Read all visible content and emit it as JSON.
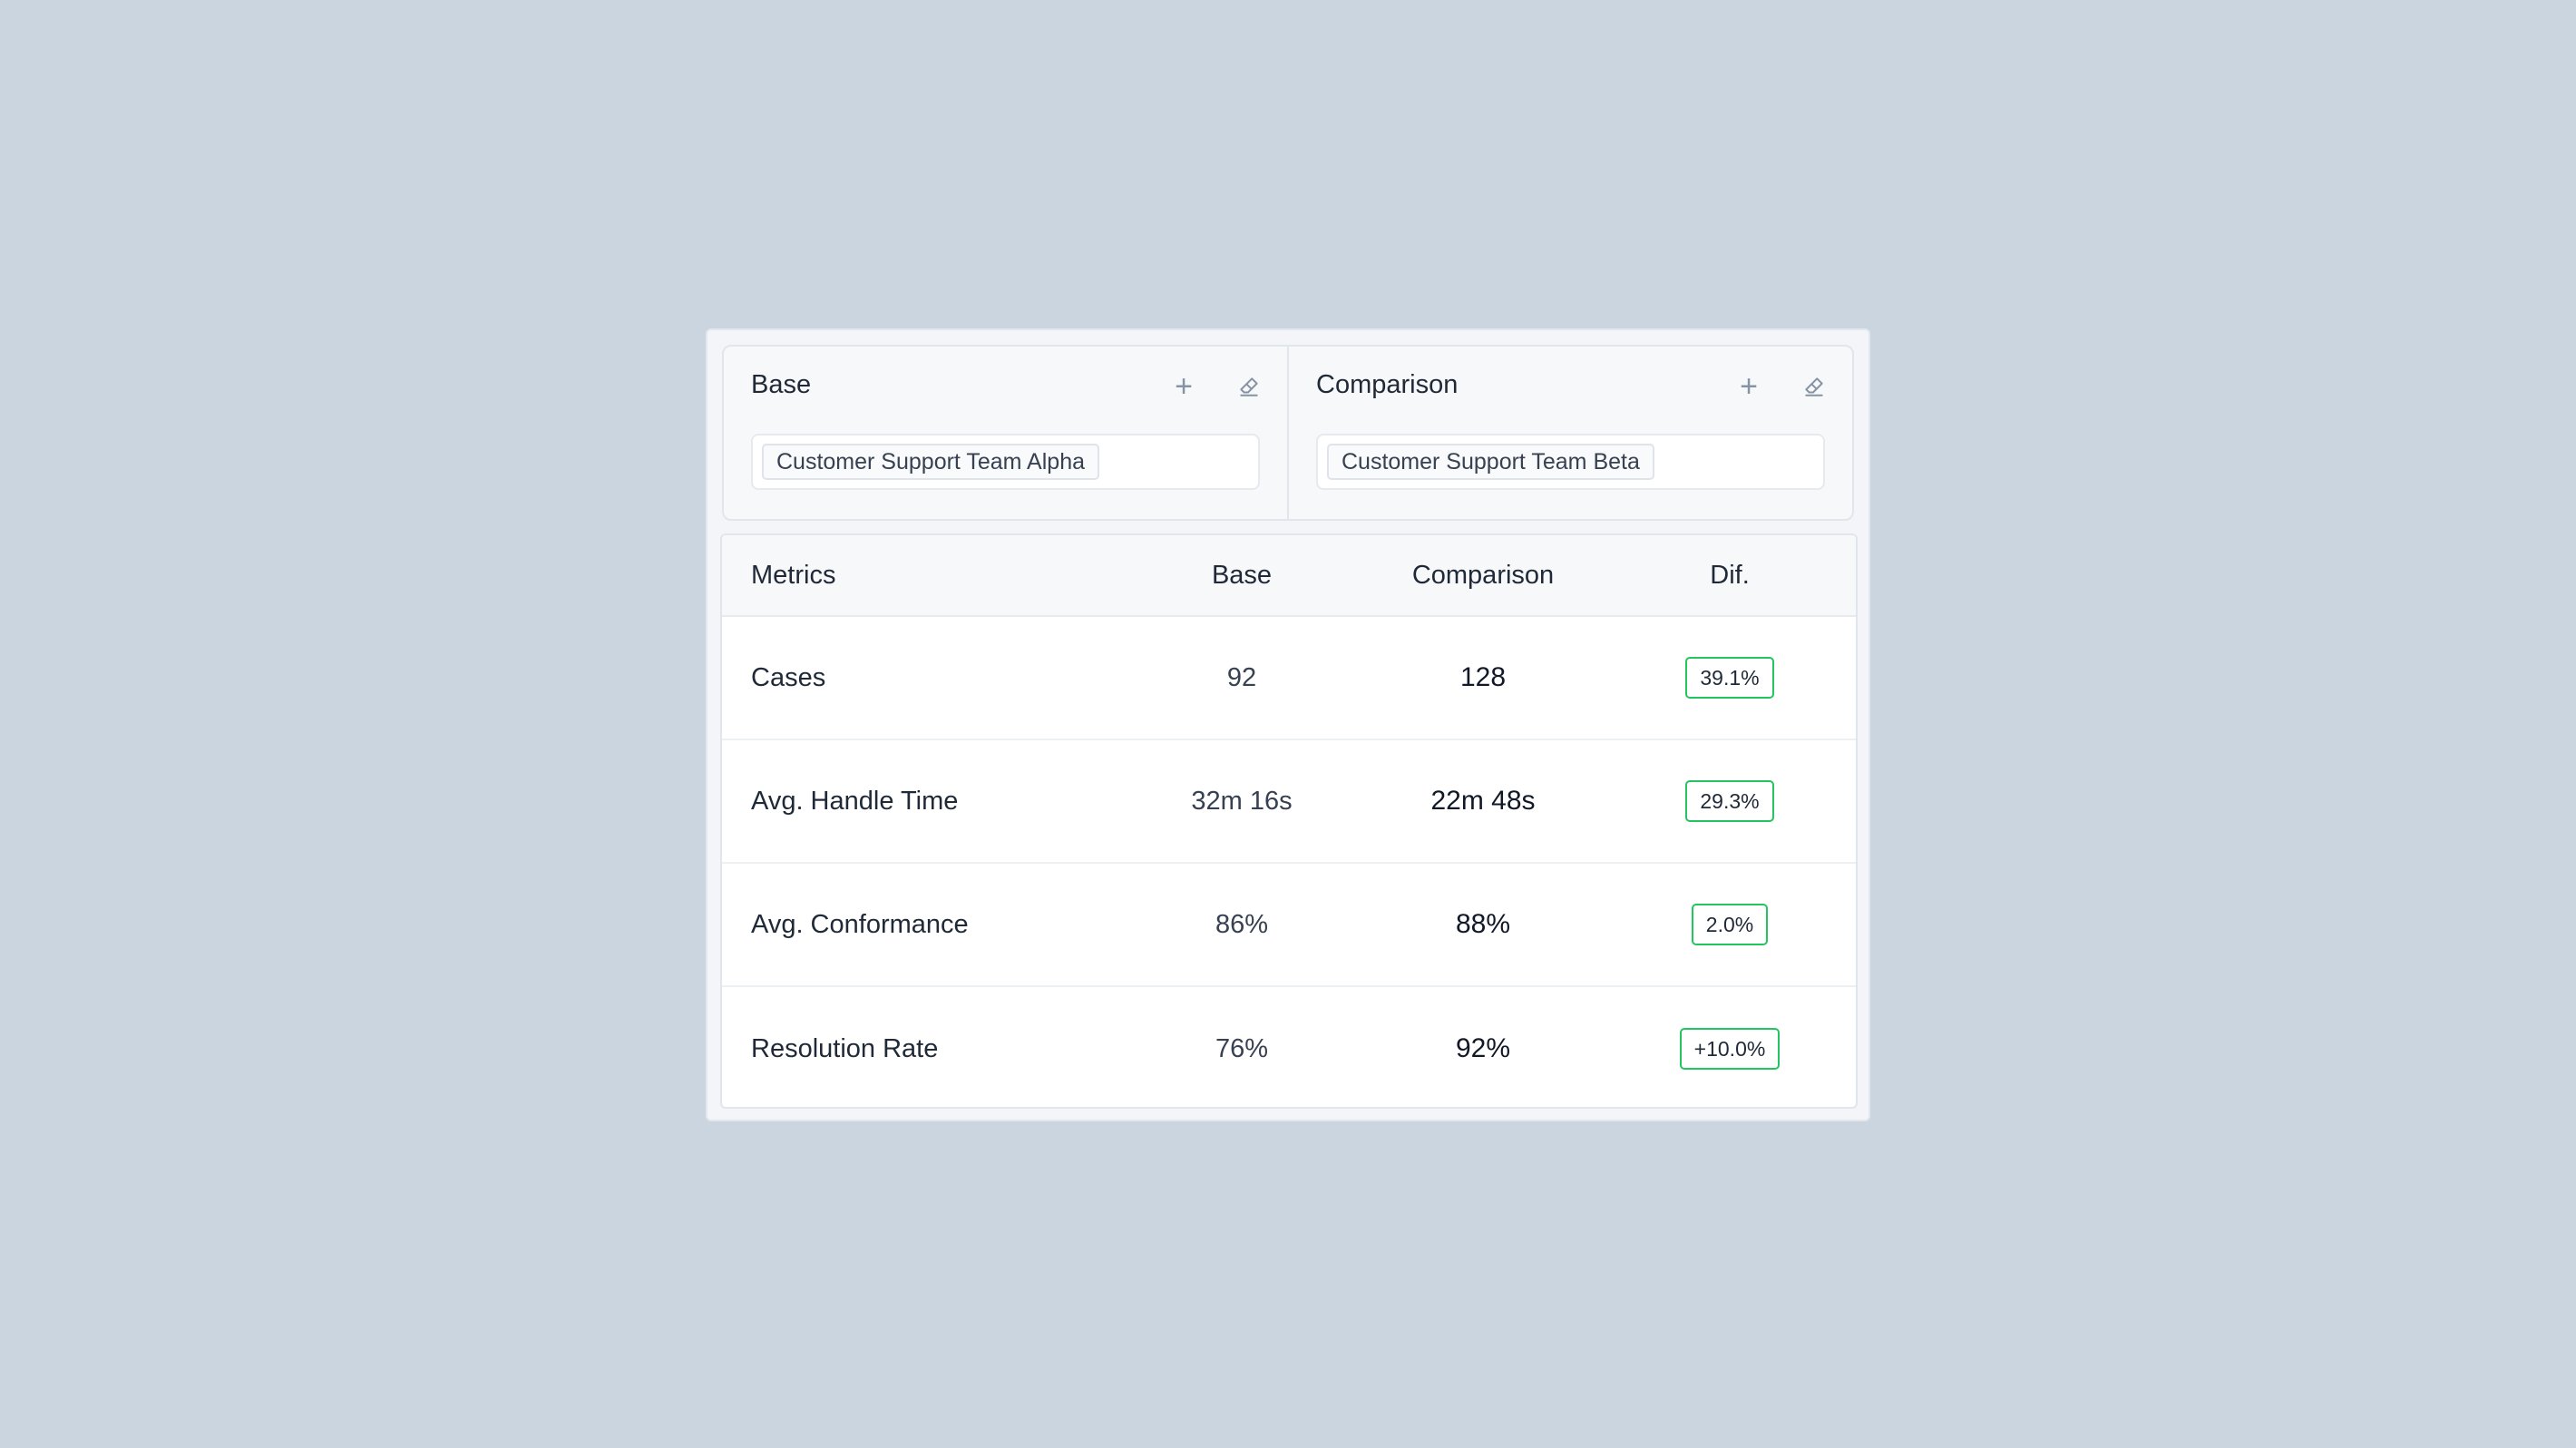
{
  "base_panel": {
    "title": "Base",
    "plus_icon": "plus-icon",
    "eraser_icon": "eraser-icon",
    "selected": "Customer Support Team Alpha"
  },
  "comparison_panel": {
    "title": "Comparison",
    "plus_icon": "plus-icon",
    "eraser_icon": "eraser-icon",
    "selected": "Customer Support Team Beta"
  },
  "table": {
    "headers": {
      "metrics": "Metrics",
      "base": "Base",
      "comparison": "Comparison",
      "dif": "Dif."
    },
    "rows": [
      {
        "metric": "Cases",
        "base": "92",
        "comparison": "128",
        "dif": "39.1%"
      },
      {
        "metric": "Avg. Handle Time",
        "base": "32m 16s",
        "comparison": "22m 48s",
        "dif": "29.3%"
      },
      {
        "metric": "Avg. Conformance",
        "base": "86%",
        "comparison": "88%",
        "dif": "2.0%"
      },
      {
        "metric": "Resolution Rate",
        "base": "76%",
        "comparison": "92%",
        "dif": "+10.0%"
      }
    ]
  },
  "colors": {
    "background": "#cbd5df",
    "badge_border": "#22c55e"
  }
}
